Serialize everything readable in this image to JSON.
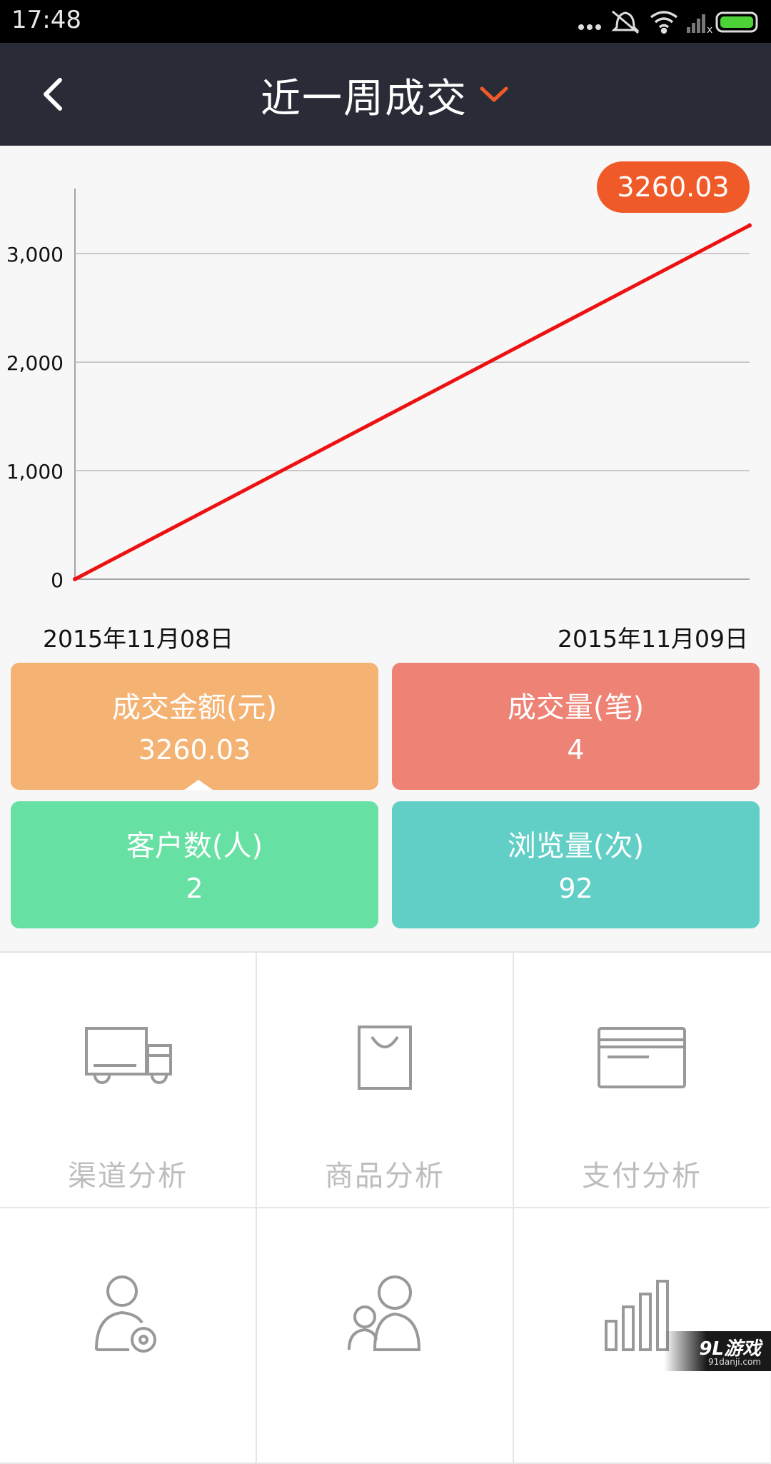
{
  "status_bar": {
    "time": "17:48",
    "icons": [
      "more-dots-icon",
      "mute-vibrate-icon",
      "wifi-icon",
      "signal-icon",
      "battery-icon"
    ],
    "battery_color": "#4cd137"
  },
  "header": {
    "title": "近一周成交",
    "back_icon": "chevron-left-icon",
    "dropdown_icon": "chevron-down-icon",
    "bg_color": "#292b36",
    "accent_color": "#f05a28"
  },
  "chart_data": {
    "type": "line",
    "x": [
      "2015年11月08日",
      "2015年11月09日"
    ],
    "series": [
      {
        "values": [
          0,
          3260.03
        ],
        "color": "#ee1111"
      }
    ],
    "y_ticks": [
      "0",
      "1,000",
      "2,000",
      "3,000"
    ],
    "ylim": [
      0,
      3600
    ],
    "grid": true,
    "highlight_value": "3260.03"
  },
  "stats": [
    {
      "label": "成交金额(元)",
      "value": "3260.03",
      "color": "#f5b373"
    },
    {
      "label": "成交量(笔)",
      "value": "4",
      "color": "#ee8275"
    },
    {
      "label": "客户数(人)",
      "value": "2",
      "color": "#67e0a3"
    },
    {
      "label": "浏览量(次)",
      "value": "92",
      "color": "#62cfc6"
    }
  ],
  "menu": [
    {
      "label": "渠道分析",
      "icon": "truck-icon"
    },
    {
      "label": "商品分析",
      "icon": "shopping-bag-icon"
    },
    {
      "label": "支付分析",
      "icon": "credit-card-icon"
    },
    {
      "label": "",
      "icon": "user-search-icon"
    },
    {
      "label": "",
      "icon": "users-icon"
    },
    {
      "label": "",
      "icon": "bar-chart-icon"
    }
  ],
  "watermark": {
    "main": "9L游戏",
    "sub": "91danji.com"
  }
}
